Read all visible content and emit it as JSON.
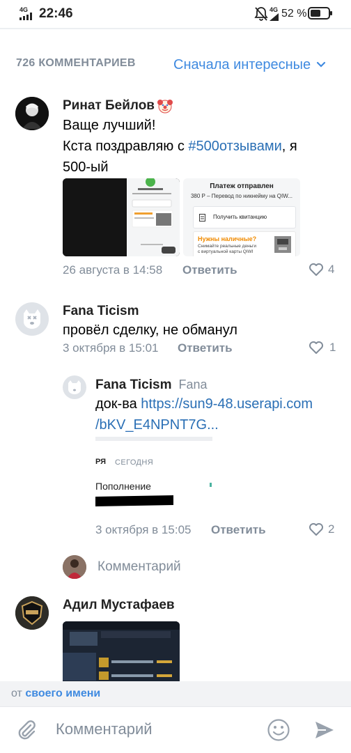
{
  "status_bar": {
    "time": "22:46",
    "network_left": "4G",
    "network_right": "4G",
    "battery_pct": "52 %"
  },
  "header": {
    "count": "726 КОММЕНТАРИЕВ",
    "sort": "Сначала интересные"
  },
  "comments": [
    {
      "author": "Ринат Бейлов",
      "text_line1": "Ваще лучший!",
      "text_line2_prefix": "Кста поздравляю с ",
      "hashtag": "#500отзывами",
      "text_line2_suffix": ", я",
      "text_line3": "500-ый",
      "date": "26 августа в 14:58",
      "reply": "Ответить",
      "likes": "4",
      "attachment2": {
        "title": "Платеж отправлен",
        "subtitle": "380 Р – Перевод по никнейму на QIW...",
        "button": "Получить квитанцию",
        "promo_title": "Нужны наличные?",
        "promo_text1": "Снимайте реальные деньги",
        "promo_text2": "с виртуальной карты QIWI"
      }
    },
    {
      "author": "Fana Ticism",
      "text": "провёл сделку, не обманул",
      "date": "3 октября в 15:01",
      "reply": "Ответить",
      "likes": "1"
    },
    {
      "author": "Fana Ticism",
      "reply_to": "Fana",
      "text_prefix": "док-ва ",
      "link_line1": "https://sun9-48.userapi.com",
      "link_line2": "/bKV_E4NPNT7G...",
      "preview_tag": "РЯ",
      "preview_date": "СЕГОДНЯ",
      "preview_item": "Пополнение",
      "date": "3 октября в 15:05",
      "reply": "Ответить",
      "likes": "2"
    }
  ],
  "reply_field": {
    "placeholder": "Комментарий"
  },
  "next_comment": {
    "author": "Адил Мустафаев"
  },
  "from_bar": {
    "prefix": "от ",
    "link": "своего имени"
  },
  "composer": {
    "placeholder": "Комментарий"
  },
  "colors": {
    "accent": "#3f8ae0",
    "link": "#2a6fb5",
    "secondary_text": "#818c99",
    "like_red": "#e64646"
  }
}
